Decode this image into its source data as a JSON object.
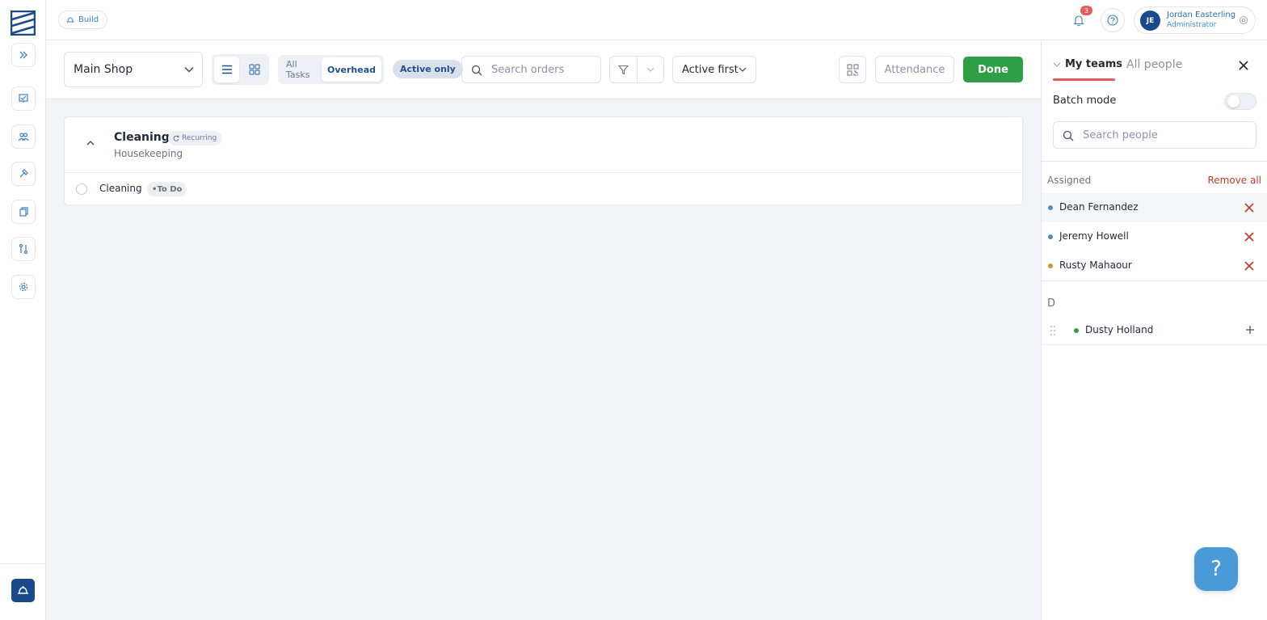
{
  "header": {
    "build_label": "Build",
    "notifications_count": "3",
    "user": {
      "initials": "JE",
      "name": "Jordan Easterling",
      "role": "Administrator"
    }
  },
  "rail": {
    "icons": [
      "expand-icon",
      "orders-icon",
      "people-icon",
      "tools-icon",
      "copy-icon",
      "workflow-icon",
      "settings-icon"
    ]
  },
  "toolbar": {
    "shop": "Main Shop",
    "task_tabs": [
      "All Tasks",
      "Overhead"
    ],
    "active_task_tab": "Overhead",
    "active_only": "Active only",
    "search_placeholder": "Search orders",
    "sort": "Active first",
    "attendance": "Attendance",
    "done": "Done"
  },
  "task_group": {
    "title": "Cleaning",
    "badge": "Recurring",
    "subtitle": "Housekeeping",
    "tasks": [
      {
        "name": "Cleaning",
        "status": "To Do"
      }
    ]
  },
  "panel": {
    "tabs": [
      "My teams",
      "All people"
    ],
    "active_tab": "My teams",
    "batch_mode_label": "Batch mode",
    "batch_mode_on": false,
    "search_placeholder": "Search people",
    "assigned_label": "Assigned",
    "remove_all": "Remove all",
    "assigned": [
      {
        "name": "Dean Fernandez",
        "color": "#4a8fc4"
      },
      {
        "name": "Jeremy Howell",
        "color": "#4a8fc4"
      },
      {
        "name": "Rusty Mahaour",
        "color": "#e0922e"
      }
    ],
    "groups": [
      {
        "letter": "D",
        "people": [
          {
            "name": "Dusty Holland",
            "color": "#2f9e44"
          }
        ]
      }
    ]
  },
  "help_fab": "?",
  "colors": {
    "brand": "#1a4a8a",
    "done": "#2f9e44",
    "accent_red": "#e35d5d"
  }
}
